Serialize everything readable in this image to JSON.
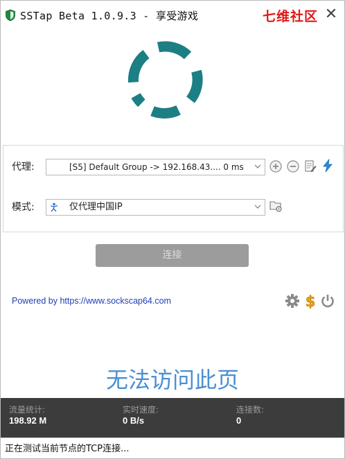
{
  "window": {
    "title": "SSTap Beta 1.0.9.3 - 享受游戏",
    "watermark": "七维社区",
    "close_glyph": "✕"
  },
  "loading": {
    "icon": "spinner-ring",
    "color": "#1c7f84"
  },
  "settings": {
    "proxy_label": "代理:",
    "proxy_value": "[S5] Default Group -> 192.168.43....  0 ms",
    "mode_label": "模式:",
    "mode_value": "仅代理中国IP",
    "proxy_icons": [
      "plus-circle-icon",
      "minus-circle-icon",
      "edit-document-icon",
      "lightning-icon"
    ],
    "mode_icons": [
      "folder-settings-icon"
    ]
  },
  "connect_button": {
    "label": "连接",
    "enabled": false
  },
  "footer_link": {
    "prefix": "Powered by ",
    "url_text": "https://www.sockscap64.com"
  },
  "bottom_icons": [
    "gear-icon",
    "dollar-icon",
    "power-icon"
  ],
  "message": "无法访问此页",
  "stats": {
    "traffic_label": "流量统计:",
    "traffic_value": "198.92 M",
    "speed_label": "实时速度:",
    "speed_value": "0 B/s",
    "connections_label": "连接数:",
    "connections_value": "0"
  },
  "status": "正在测试当前节点的TCP连接...",
  "colors": {
    "accent": "#1c7f84",
    "watermark": "#e01818",
    "link": "#1e3fb5",
    "message": "#4a8fd3",
    "stats_bg": "#3c3c3c",
    "button_disabled": "#9c9c9c"
  }
}
